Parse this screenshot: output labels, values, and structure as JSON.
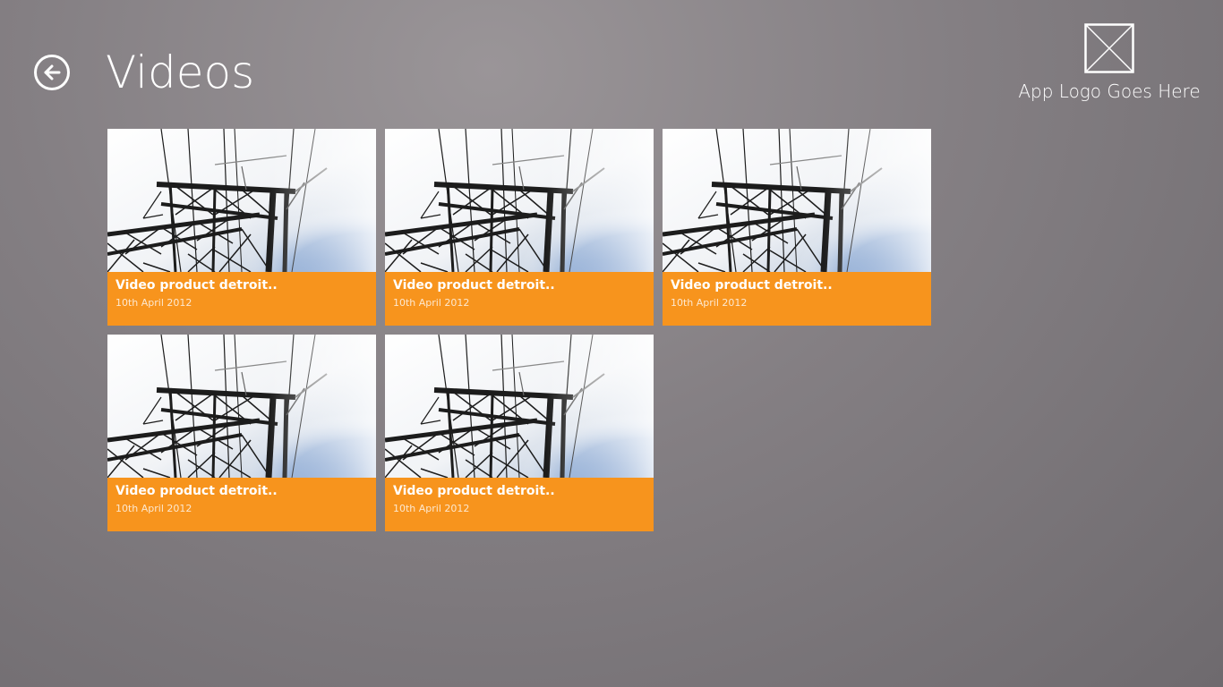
{
  "header": {
    "title": "Videos",
    "back_icon": "back-arrow-icon"
  },
  "logo": {
    "text": "App Logo Goes Here",
    "icon": "image-placeholder-icon"
  },
  "colors": {
    "tile_caption": "#f7941d",
    "text": "#ffffff"
  },
  "videos": [
    {
      "title": "Video product detroit..",
      "date": "10th April 2012"
    },
    {
      "title": "Video product detroit..",
      "date": "10th April 2012"
    },
    {
      "title": "Video product detroit..",
      "date": "10th April 2012"
    },
    {
      "title": "Video product detroit..",
      "date": "10th April 2012"
    },
    {
      "title": "Video product detroit..",
      "date": "10th April 2012"
    }
  ]
}
